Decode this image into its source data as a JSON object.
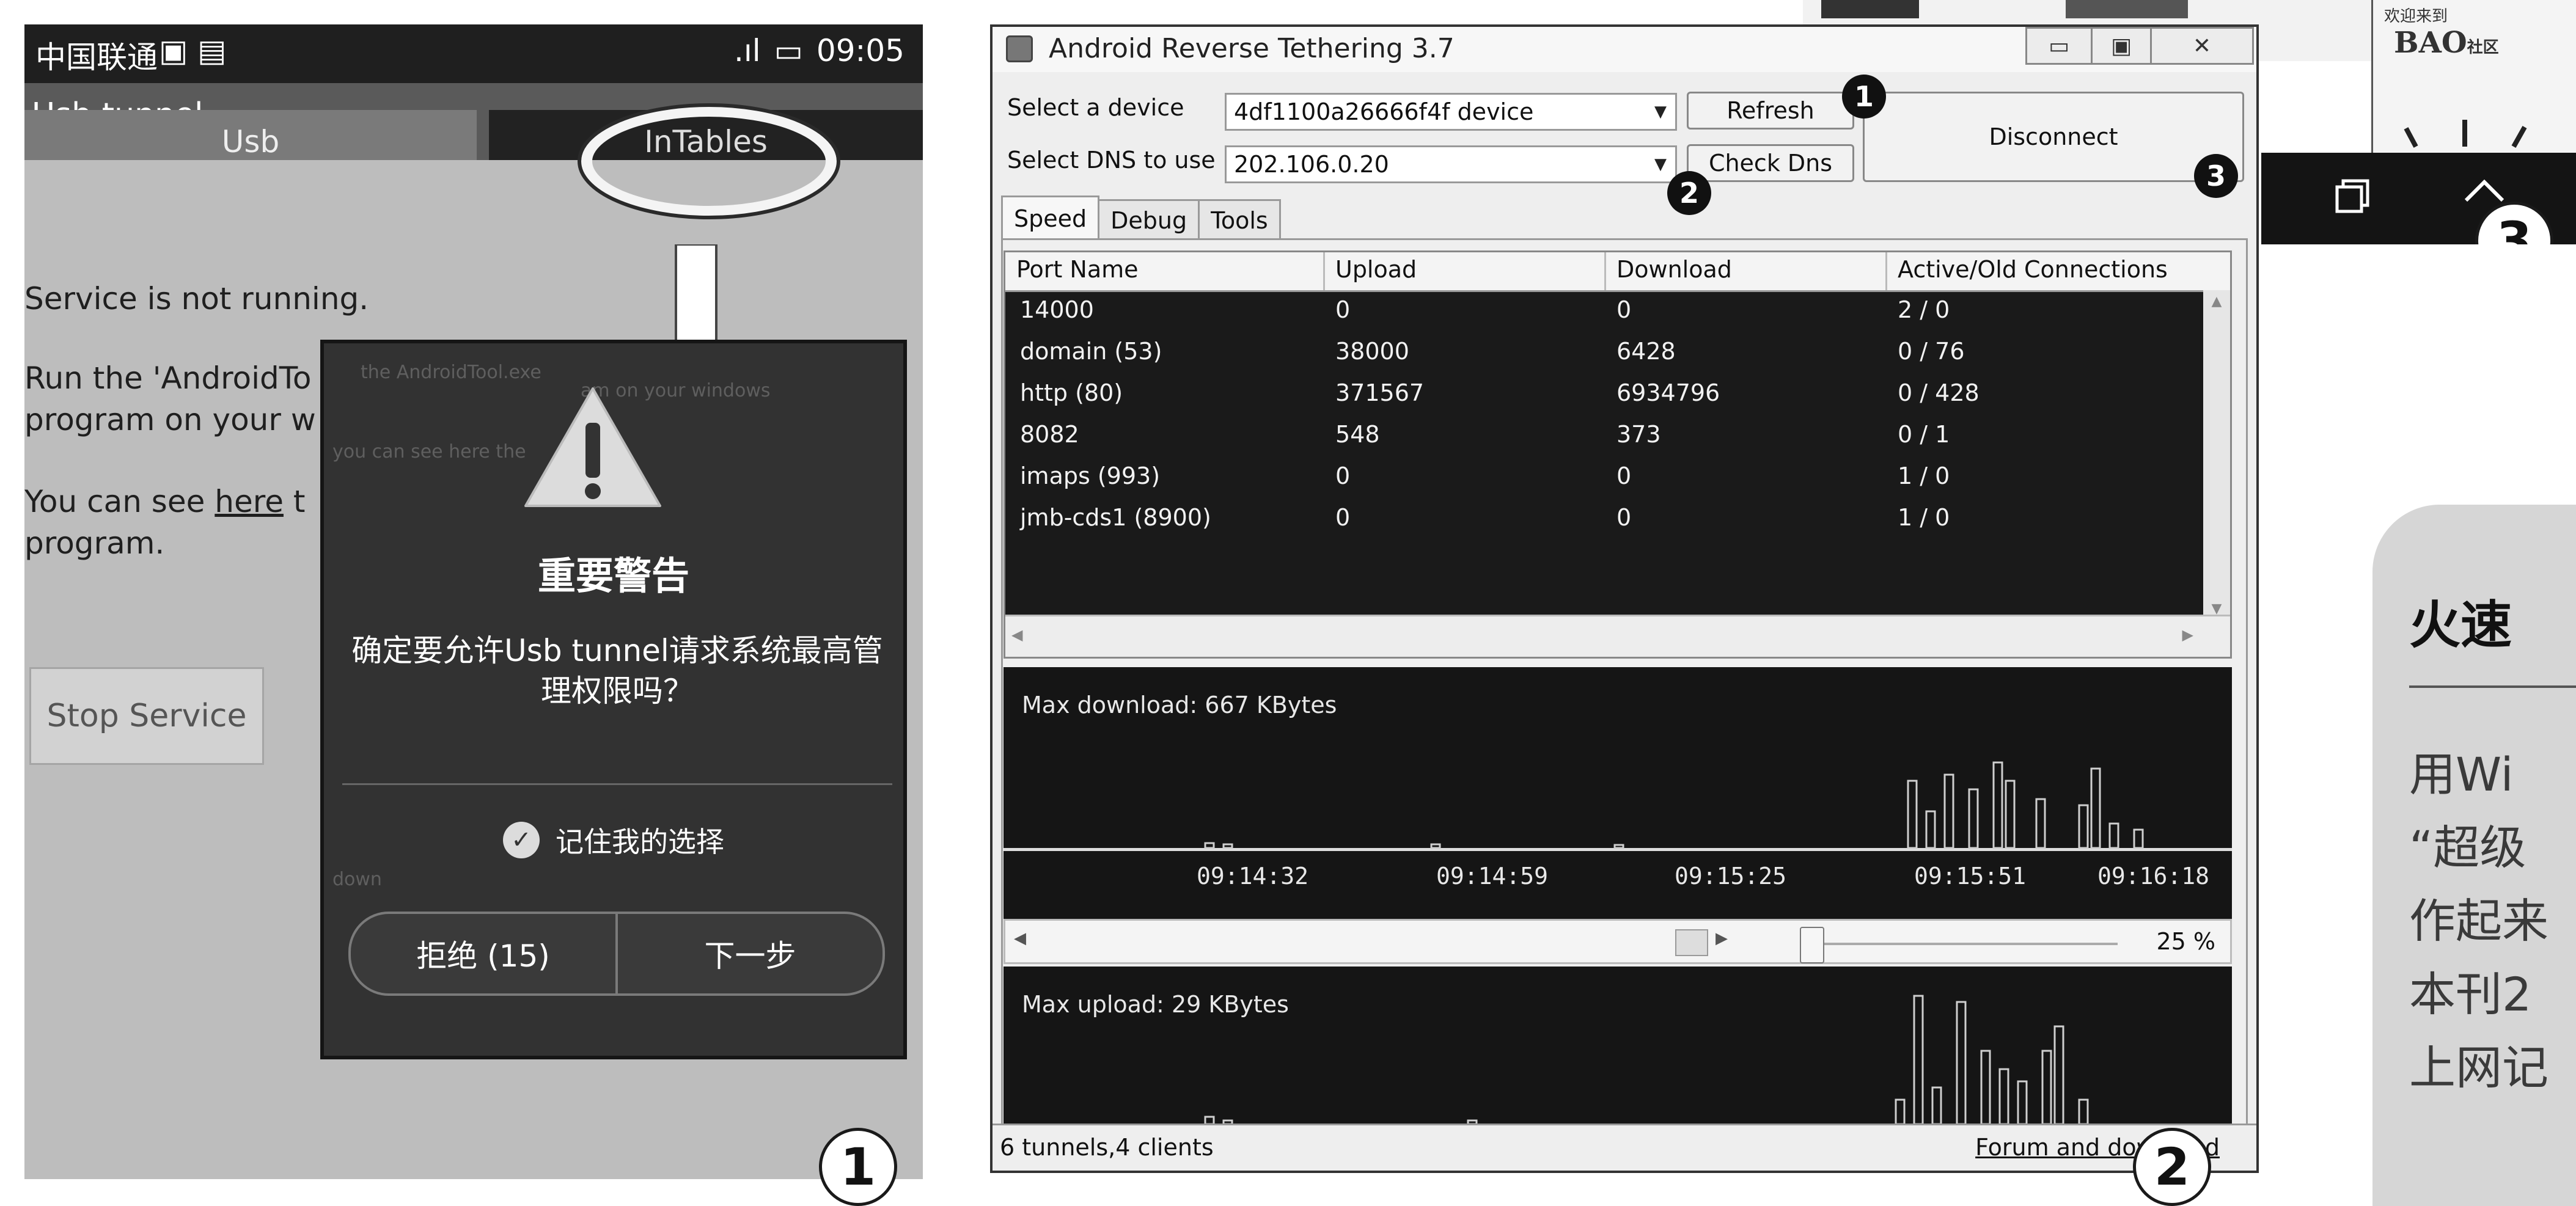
{
  "phone": {
    "status": {
      "carrier": "中国联通",
      "signal": ".ıl",
      "time": "09:05"
    },
    "app_title": "Usb tunnel",
    "tabs": [
      {
        "label": "Usb"
      },
      {
        "label": "InTables"
      }
    ],
    "body_lines": [
      "Service is not running.",
      "Run the 'AndroidTo",
      "program on your w",
      "You can see",
      "here",
      "t",
      "program."
    ],
    "stop_button": "Stop Service",
    "dialog": {
      "faint_lines": [
        "the AndroidTool.exe",
        "am on your windows",
        "you can see here the",
        "down"
      ],
      "title": "重要警告",
      "message": "确定要允许Usb tunnel请求系统最高管理权限吗？",
      "remember": "记住我的选择",
      "deny": "拒绝 (15)",
      "next": "下一步"
    },
    "corner_label": "1"
  },
  "win": {
    "title": "Android Reverse Tethering 3.7",
    "device_label": "Select a device",
    "device_value": "4df1100a26666f4f  device",
    "dns_label": "Select DNS to use",
    "dns_value": "202.106.0.20",
    "refresh": "Refresh",
    "check_dns": "Check Dns",
    "disconnect": "Disconnect",
    "tabs": [
      "Speed",
      "Debug",
      "Tools"
    ],
    "columns": [
      "Port Name",
      "Upload",
      "Download",
      "Active/Old Connections"
    ],
    "rows": [
      [
        "14000",
        "0",
        "0",
        "2 / 0"
      ],
      [
        "domain (53)",
        "38000",
        "6428",
        "0 / 76"
      ],
      [
        "http (80)",
        "371567",
        "6934796",
        "0 / 428"
      ],
      [
        "8082",
        "548",
        "373",
        "0 / 1"
      ],
      [
        "imaps (993)",
        "0",
        "0",
        "1 / 0"
      ],
      [
        "jmb-cds1 (8900)",
        "0",
        "0",
        "1 / 0"
      ]
    ],
    "download_title": "Max download: 667 KBytes",
    "upload_title": "Max upload: 29 KBytes",
    "time_ticks": [
      "09:14:32",
      "09:14:59",
      "09:15:25",
      "09:15:51",
      "09:16:18"
    ],
    "zoom": "25 %",
    "status_left": "6 tunnels,4 clients",
    "status_right": "Forum and download",
    "badges": [
      "1",
      "2",
      "3"
    ],
    "corner_label": "2"
  },
  "clip": {
    "top_text": "欢迎来到",
    "brand": "BAO",
    "brand_suffix": "社区",
    "corner_label": "3"
  },
  "card": {
    "heading": "火速",
    "lines": [
      "用Wi",
      "“超级",
      "作起来",
      "本刊2",
      "上网记"
    ]
  },
  "colors": {
    "dark": "#1a1a1a",
    "dialog": "#323232",
    "phone_bg": "#bdbdbd",
    "window_bg": "#eeeeee"
  }
}
